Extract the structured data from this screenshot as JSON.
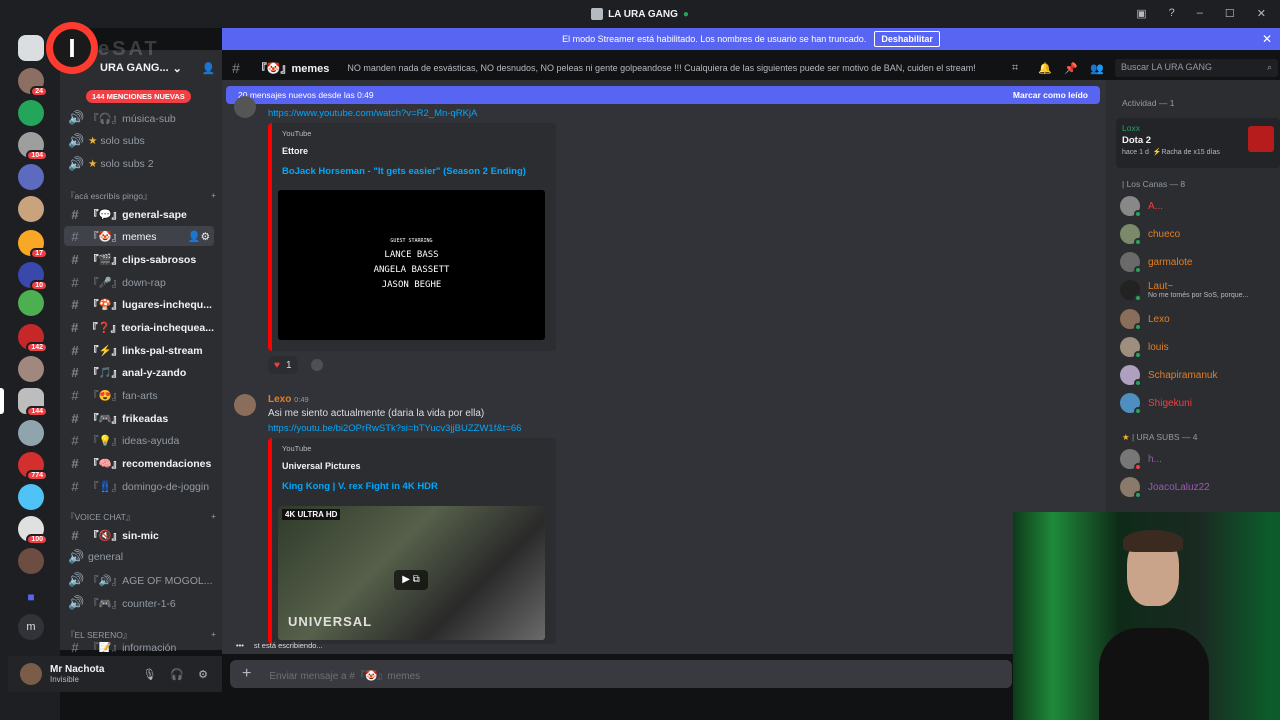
{
  "window": {
    "title": "LA URA GANG"
  },
  "streamer_banner": {
    "text": "El modo Streamer está habilitado. Los nombres de usuario se han truncado.",
    "button": "Deshabilitar"
  },
  "server": {
    "name": "URA GANG..."
  },
  "logo": {
    "text": "I",
    "overlay": "eSAT"
  },
  "guild_badges": [
    "24",
    "104",
    "17",
    "10",
    "142",
    "144",
    "774",
    "100"
  ],
  "mentions_pill": "144 MENCIONES NUEVAS",
  "categories": {
    "acaescribis": "『acá escribís pingo』",
    "voice": "『VOICE CHAT』",
    "sereno": "『EL SERENO』"
  },
  "channels": [
    "『🎧』música-sub",
    "solo subs",
    "solo subs 2",
    "『💬』general-sape",
    "『🤡』memes",
    "『🎬』clips-sabrosos",
    "『🎤』down-rap",
    "『🍄』lugares-inchequ...",
    "『❓』teoria-inchequea...",
    "『⚡』links-pal-stream",
    "『🎵』anal-y-zando",
    "『😍』fan-arts",
    "『🎮』frikeadas",
    "『💡』ideas-ayuda",
    "『🧠』recomendaciones",
    "『👖』domingo-de-joggin",
    "『🔇』sin-mic",
    "general",
    "『🔊』AGE OF MOGOL...",
    "『🎮』counter-1-6",
    "『📝』información"
  ],
  "user": {
    "name": "Mr Nachota",
    "status": "Invisible"
  },
  "header": {
    "channel": "『🤡』memes",
    "topic": "NO manden nada de esvásticas, NO desnudos, NO peleas ni gente golpeandose !!! Cualquiera de las siguientes puede ser motivo de BAN, cuiden el stream!"
  },
  "search": {
    "placeholder": "Buscar LA URA GANG"
  },
  "new_messages": {
    "text": "20 mensajes nuevos desde las 0:49",
    "action": "Marcar como leído"
  },
  "message1": {
    "link": "https://www.youtube.com/watch?v=R2_Mn-qRKjA",
    "embed_provider": "YouTube",
    "embed_author": "Ettore",
    "embed_title": "BoJack Horseman - \"It gets easier\" (Season 2 Ending)",
    "video_text": [
      "GUEST STARRING",
      "LANCE BASS",
      "ANGELA BASSETT",
      "JASON BEGHE"
    ],
    "reaction_count": "1"
  },
  "message2": {
    "author": "Lexo",
    "time": "0:49",
    "text": "Asi me siento actualmente (daria la vida por ella)",
    "link": "https://youtu.be/bi2OPrRwSTk?si=bTYucv3jjBUZZW1f&t=66",
    "embed_provider": "YouTube",
    "embed_author": "Universal Pictures",
    "embed_title": "King Kong | V. rex Fight in 4K HDR",
    "thumb_badge": "4K ULTRA HD",
    "thumb_logo": "UNIVERSAL"
  },
  "typing": "st está escribiendo...",
  "composer": {
    "placeholder": "Enviar mensaje a #『🤡』memes"
  },
  "members": {
    "activity_title": "Actividad — 1",
    "activity": {
      "user": "Loxx",
      "game": "Dota 2",
      "ago": "hace 1 d",
      "streak": "Racha de x15 días"
    },
    "sections": [
      {
        "title": "| Los Canas — 8",
        "users": [
          {
            "name": "A...",
            "color": "#f23f43"
          },
          {
            "name": "chueco",
            "color": "#e67e22"
          },
          {
            "name": "garmalote",
            "color": "#e67e22"
          },
          {
            "name": "Laut~",
            "color": "#e67e22",
            "sub": "No me tomés por SoS, porque..."
          },
          {
            "name": "Lexo",
            "color": "#e67e22"
          },
          {
            "name": "louis",
            "color": "#e67e22"
          },
          {
            "name": "Schapiramanuk",
            "color": "#e67e22"
          },
          {
            "name": "Shigekuni",
            "color": "#f23f43"
          }
        ]
      },
      {
        "title": "| URA SUBS — 4",
        "users": [
          {
            "name": "h...",
            "color": "#9b59b6"
          },
          {
            "name": "JoacoLaluz22",
            "color": "#9b59b6"
          }
        ]
      }
    ]
  },
  "colors": {
    "accent": "#5865f2",
    "danger": "#f23f43",
    "link": "#00a8fc",
    "online": "#23a55a"
  }
}
